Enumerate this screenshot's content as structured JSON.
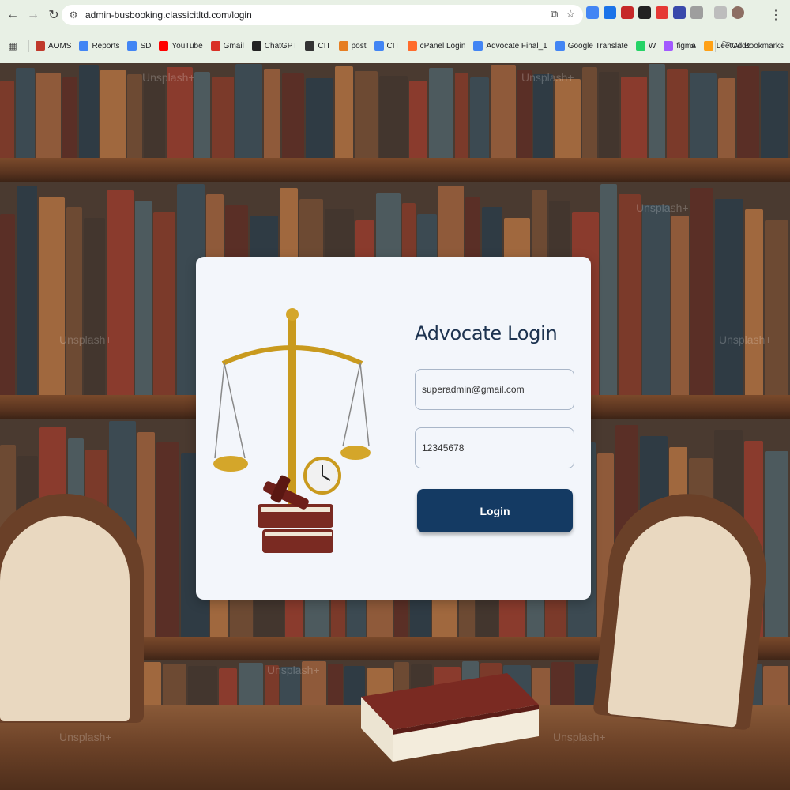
{
  "browser": {
    "url": "admin-busbooking.classicitltd.com/login",
    "bookmarks": [
      {
        "label": "AOMS",
        "icon": "aoms-icon",
        "color": "#c0392b"
      },
      {
        "label": "Reports",
        "icon": "docs-icon",
        "color": "#4285f4"
      },
      {
        "label": "SD",
        "icon": "docs-icon",
        "color": "#4285f4"
      },
      {
        "label": "YouTube",
        "icon": "youtube-icon",
        "color": "#ff0000"
      },
      {
        "label": "Gmail",
        "icon": "gmail-icon",
        "color": "#d93025"
      },
      {
        "label": "ChatGPT",
        "icon": "chatgpt-icon",
        "color": "#222222"
      },
      {
        "label": "CIT",
        "icon": "globe-icon",
        "color": "#333333"
      },
      {
        "label": "post",
        "icon": "post-icon",
        "color": "#e67e22"
      },
      {
        "label": "CIT",
        "icon": "docs-icon",
        "color": "#4285f4"
      },
      {
        "label": "cPanel Login",
        "icon": "cpanel-icon",
        "color": "#ff6c2c"
      },
      {
        "label": "Advocate Final_1",
        "icon": "docs-icon",
        "color": "#4285f4"
      },
      {
        "label": "Google Translate",
        "icon": "translate-icon",
        "color": "#4285f4"
      },
      {
        "label": "W",
        "icon": "whatsapp-icon",
        "color": "#25d366"
      },
      {
        "label": "figma",
        "icon": "figma-icon",
        "color": "#a259ff"
      },
      {
        "label": "LeetCode",
        "icon": "leetcode-icon",
        "color": "#ffa116"
      }
    ],
    "all_bookmarks": "All Bookmarks",
    "overflow": "»"
  },
  "login": {
    "title": "Advocate Login",
    "email_value": "superadmin@gmail.com",
    "password_value": "12345678",
    "button_label": "Login"
  },
  "watermark": "Unsplash+",
  "colors": {
    "primary": "#143a63",
    "title": "#1d3350",
    "card_bg": "#f3f6fb"
  }
}
